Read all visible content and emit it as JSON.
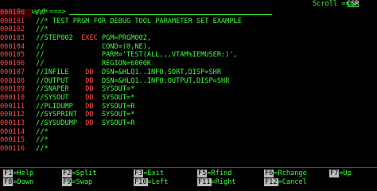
{
  "command_bar": {
    "label": "Command ===>",
    "scroll_label": "Scroll ===>",
    "scroll_value": "CSR"
  },
  "lines": [
    {
      "num": "000100",
      "text": " //*",
      "top": true
    },
    {
      "num": "000101",
      "text": " //* TEST PRGM FOR DEBUG TOOL PARAMETER SET EXAMPLE"
    },
    {
      "num": "000102",
      "text": " //*"
    },
    {
      "num": "000103",
      "text": " //STEP002  EXEC PGM=PRGM002,",
      "kw": "EXEC"
    },
    {
      "num": "000104",
      "text": " //              COND=(0,NE),"
    },
    {
      "num": "000105",
      "text": " //              PARM='TEST(ALL,,,VTAM%IEMUSER:)',"
    },
    {
      "num": "000106",
      "text": " //              REGION=6000K"
    },
    {
      "num": "000107",
      "text": " //INFILE    DD  DSN=&HLQ1..INFO.SORT,DISP=SHR",
      "kw": "DD"
    },
    {
      "num": "000108",
      "text": " //OUTPUT    DD  DSN=&HLQ1..INFO.OUTPUT,DISP=SHR",
      "kw": "DD"
    },
    {
      "num": "000109",
      "text": " //SNAPER    DD  SYSOUT=*",
      "kw": "DD"
    },
    {
      "num": "000110",
      "text": " //SYSOUT    DD  SYSOUT=*",
      "kw": "DD"
    },
    {
      "num": "000111",
      "text": " //PLIDUMP   DD  SYSOUT=R",
      "kw": "DD"
    },
    {
      "num": "000112",
      "text": " //SYSPRINT  DD  SYSOUT=*",
      "kw": "DD"
    },
    {
      "num": "000113",
      "text": " //SYSUDUMP  DD  SYSOUT=R",
      "kw": "DD"
    },
    {
      "num": "000114",
      "text": " //*"
    },
    {
      "num": "000115",
      "text": " //*"
    },
    {
      "num": "000116",
      "text": " //*"
    }
  ],
  "function_keys": [
    [
      {
        "key": "F1",
        "label": "=Help"
      },
      {
        "key": "F2",
        "label": "=Split"
      },
      {
        "key": "F3",
        "label": "=Exit"
      },
      {
        "key": "F5",
        "label": "=Rfind"
      },
      {
        "key": "F6",
        "label": "=Rchange"
      },
      {
        "key": "F7",
        "label": "=Up"
      }
    ],
    [
      {
        "key": "F8",
        "label": "=Down"
      },
      {
        "key": "F9",
        "label": "=Swap"
      },
      {
        "key": "F10",
        "label": "=Left"
      },
      {
        "key": "F11",
        "label": "=Right"
      },
      {
        "key": "F12",
        "label": "=Cancel"
      }
    ]
  ],
  "colors": {
    "text": "#3cff3c",
    "line_numbers": "#ff4a4a",
    "keywords": "#ff4a4a",
    "key_background": "#bbbbbb",
    "background": "#000000"
  }
}
